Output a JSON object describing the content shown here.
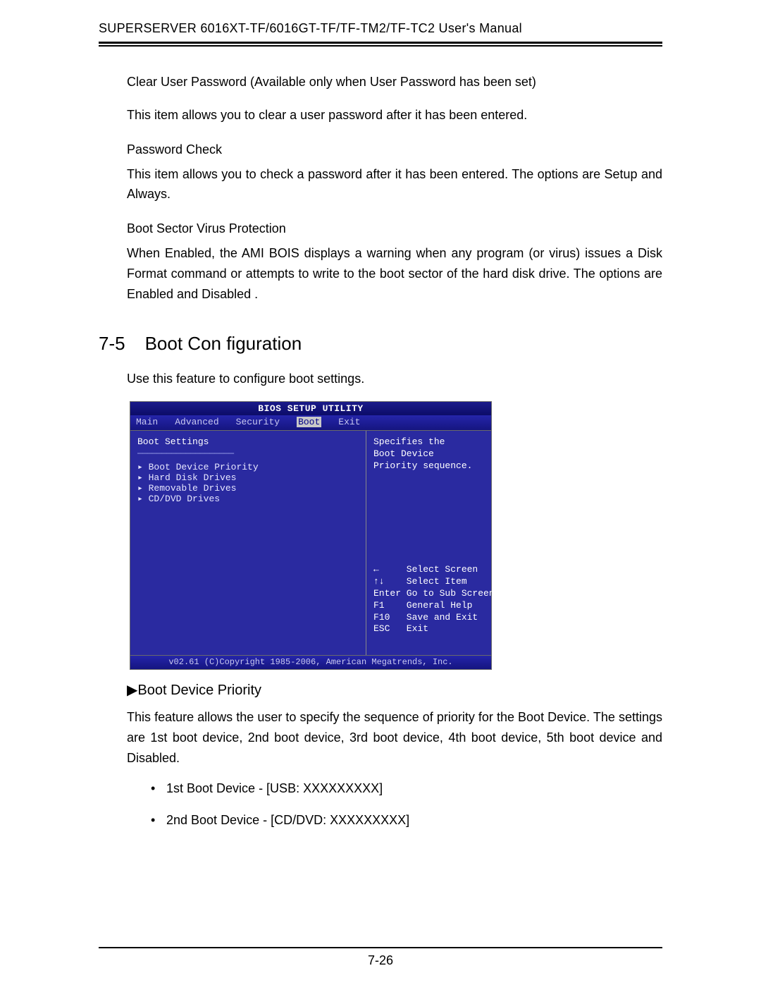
{
  "header": "SUPERSERVER 6016XT-TF/6016GT-TF/TF-TM2/TF-TC2 User's Manual",
  "body": {
    "clear_pw_head": "Clear User Password (Available only when User Password has been set)",
    "clear_pw_text": "This item allows you to clear a user password after it has been entered.",
    "pw_check_head": "Password Check",
    "pw_check_text": "This item allows you to check a password after it has been entered. The options are Setup and Always.",
    "boot_sector_head": "Boot Sector Virus Protection",
    "boot_sector_text": "When Enabled, the AMI BOIS displays a warning when any program (or virus) issues a Disk Format command or attempts to write to the boot sector of the hard disk drive. The options are Enabled and Disabled .",
    "section_num": "7-5",
    "section_title": "Boot Con figuration",
    "section_intro": "Use this feature to configure boot settings.",
    "sub_section": "Boot Device Priority",
    "sub_section_text": "This feature allows the user to specify the sequence of priority for the Boot Device. The settings are 1st boot device, 2nd boot device, 3rd boot device, 4th boot device, 5th boot device and Disabled.",
    "bullets": [
      "1st Boot Device - [USB: XXXXXXXXX]",
      "2nd Boot Device - [CD/DVD: XXXXXXXXX]"
    ]
  },
  "bios": {
    "title": "BIOS SETUP UTILITY",
    "tabs": [
      "Main",
      "Advanced",
      "Security",
      "Boot",
      "Exit"
    ],
    "active_tab": "Boot",
    "panel_header": "Boot Settings",
    "separator": "────────────────────",
    "items": [
      "▸ Boot Device Priority",
      "▸ Hard Disk Drives",
      "▸ Removable Drives",
      "▸ CD/DVD Drives"
    ],
    "help": "Specifies the\nBoot Device\nPriority sequence.",
    "keys": "←     Select Screen\n↑↓    Select Item\nEnter Go to Sub Screen\nF1    General Help\nF10   Save and Exit\nESC   Exit",
    "footer": "v02.61 (C)Copyright 1985-2006, American Megatrends, Inc."
  },
  "page_number": "7-26"
}
